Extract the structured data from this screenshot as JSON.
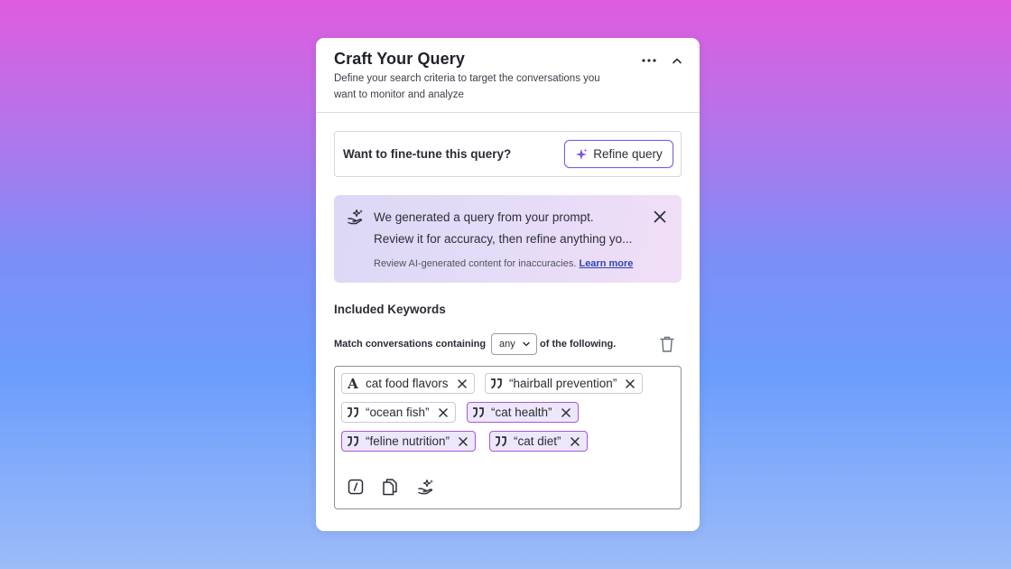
{
  "header": {
    "title": "Craft Your Query",
    "subtitle": "Define your search criteria to target the conversations you want to monitor and analyze",
    "more_icon": "more-horizontal-icon",
    "collapse_icon": "chevron-up-icon"
  },
  "refine": {
    "prompt": "Want to fine-tune this query?",
    "button_label": "Refine query",
    "button_icon": "sparkle-icon"
  },
  "ai_notice": {
    "line1": "We generated a query from your prompt.",
    "line2": "Review it for accuracy, then refine anything yo...",
    "footer": "Review AI-generated content for inaccuracies.",
    "link": "Learn more",
    "icon": "hand-sparkle-icon"
  },
  "keywords": {
    "section_title": "Included Keywords",
    "match_prefix": "Match conversations containing",
    "match_value": "any",
    "match_suffix": "of the following.",
    "chips": [
      {
        "label": "cat food flavors",
        "type": "text",
        "highlighted": false
      },
      {
        "label": "“hairball prevention”",
        "type": "phrase",
        "highlighted": false
      },
      {
        "label": "“ocean fish”",
        "type": "phrase",
        "highlighted": false
      },
      {
        "label": "“cat health”",
        "type": "phrase",
        "highlighted": true
      },
      {
        "label": "“feline nutrition”",
        "type": "phrase",
        "highlighted": true
      },
      {
        "label": "“cat diet”",
        "type": "phrase",
        "highlighted": true
      }
    ],
    "tools": [
      "slash-command-icon",
      "copy-icon",
      "ai-assist-icon"
    ]
  },
  "colors": {
    "accent": "#7c5fe0",
    "chip_highlight_bg": "#eee6fb",
    "chip_highlight_border": "#a45ad6",
    "link": "#2f46b4"
  }
}
